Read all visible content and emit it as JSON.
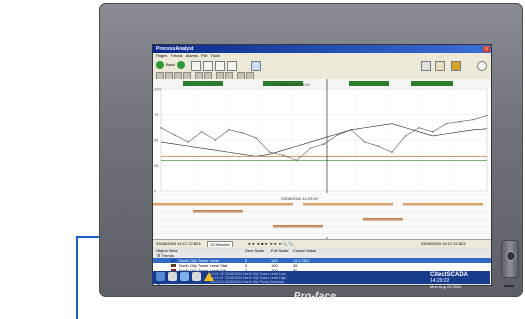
{
  "window": {
    "title": "ProcessAnalyst",
    "close_label": "x"
  },
  "menu": [
    "Pages",
    "Trends",
    "Alarms",
    "File",
    "Tools"
  ],
  "nav": {
    "back_label": "Back"
  },
  "chart": {
    "top_time": "23/08/2004 14:29:00",
    "cursor_time": "23/08/2004 14:29:00",
    "y_ticks": [
      "100",
      "75",
      "50",
      "25",
      "0"
    ]
  },
  "legend": {
    "start_time": "23/08/2004 14:17:12.823",
    "span": "10 Minutes",
    "end_time": "23/08/2004 14:27:12.823"
  },
  "grid": {
    "headers": [
      "Object View",
      "Zero Scale",
      "Full Scale",
      "Cursor Value"
    ],
    "rows": [
      {
        "type": "group",
        "name": "Trends"
      },
      {
        "type": "item",
        "name": "North Oily Tower Level",
        "zero": "0",
        "full": "100",
        "value": "14.17351",
        "color": "#1f4fa8",
        "selected": true
      },
      {
        "type": "item",
        "name": "North Oily Tower Level Stat",
        "zero": "0",
        "full": "100",
        "value": "35",
        "color": "#5a3f1c"
      },
      {
        "type": "item",
        "name": "North Oily Tower Level Sat",
        "zero": "0",
        "full": "100",
        "value": "80",
        "color": "#8b2020"
      },
      {
        "type": "item",
        "name": "North Oily Tower Flow",
        "zero": "0",
        "full": "1000",
        "value": "314.115003",
        "color": "#2a8a2a"
      },
      {
        "type": "item",
        "name": "North Oily Pump Run",
        "zero": "0",
        "full": "1",
        "value": "1",
        "color": "#222222"
      },
      {
        "type": "group",
        "name": "Alarms"
      },
      {
        "type": "item",
        "name": "North Oily Pump Overload",
        "zero": "-",
        "full": "-",
        "value": "Off [Unacknowledged]",
        "color": "#111111"
      },
      {
        "type": "item",
        "name": "North Oily Pump Emergency Stop",
        "zero": "-",
        "full": "-",
        "value": "Off [Unacknowledged]",
        "color": "#1f3f9a"
      },
      {
        "type": "item",
        "name": "North Oily Tower Flow",
        "zero": "-",
        "full": "-",
        "value": "Off [Acknowledged]",
        "color": "#3a7a3a"
      }
    ]
  },
  "alarms": [
    "14:21:43  23/08/2004  North Oily Tower Level Low",
    "14:22:01  23/08/2004  North Oily Tower Level High",
    "14:22:15  23/08/2004  North Oily Pump Overload"
  ],
  "citect": {
    "logo": "CitectSCADA",
    "time": "14:29:22",
    "date": "Mon Aug 23 2004"
  },
  "bezel": {
    "brand": "Pro-face"
  },
  "chart_data": {
    "type": "line",
    "series": [
      {
        "values": [
          62,
          55,
          48,
          58,
          50,
          60,
          57,
          52,
          38,
          35,
          30,
          42,
          46,
          55,
          60,
          48,
          44,
          38,
          54,
          62,
          58,
          66,
          68,
          70,
          74
        ]
      },
      {
        "values": [
          48,
          46,
          44,
          42,
          40,
          38,
          36,
          34,
          36,
          40,
          44,
          48,
          52,
          56,
          60,
          62,
          64,
          66,
          62,
          58,
          54,
          56,
          58,
          60,
          61
        ]
      },
      {
        "values": [
          30,
          30,
          30,
          30,
          30,
          30,
          30,
          30,
          30,
          30,
          30,
          30,
          30,
          30,
          30,
          30,
          30,
          30,
          30,
          30,
          30,
          30,
          30,
          30,
          30
        ]
      },
      {
        "values": [
          34,
          34,
          34,
          34,
          34,
          34,
          34,
          34,
          34,
          34,
          34,
          34,
          34,
          34,
          34,
          34,
          34,
          34,
          34,
          34,
          34,
          34,
          34,
          34,
          34
        ]
      }
    ],
    "ylim": [
      0,
      100
    ],
    "colors": [
      "#707070",
      "#222222",
      "#2a8a2a",
      "#b06020"
    ]
  }
}
